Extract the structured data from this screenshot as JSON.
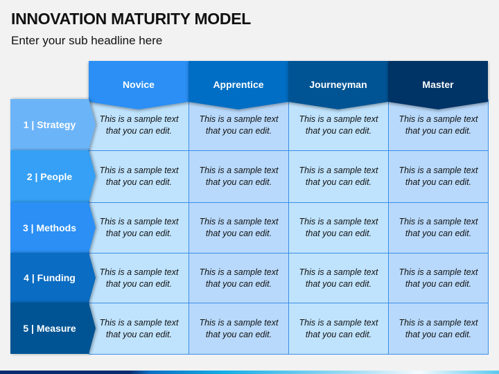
{
  "title": "INNOVATION MATURITY MODEL",
  "subtitle": "Enter your sub headline here",
  "columns": [
    {
      "label": "Novice",
      "color": "#2b8ff5"
    },
    {
      "label": "Apprentice",
      "color": "#006ec4"
    },
    {
      "label": "Journeyman",
      "color": "#005494"
    },
    {
      "label": "Master",
      "color": "#003366"
    }
  ],
  "rows": [
    {
      "label": "1 | Strategy",
      "color": "#6cb4f8",
      "cells": [
        "This is a sample text that you can edit.",
        "This is a sample text that you can edit.",
        "This is a sample text that you can edit.",
        "This is a sample text that you can edit."
      ]
    },
    {
      "label": "2 | People",
      "color": "#35a0f5",
      "cells": [
        "This is a sample text that you can edit.",
        "This is a sample text that you can edit.",
        "This is a sample text that you can edit.",
        "This is a sample text that you can edit."
      ]
    },
    {
      "label": "3 | Methods",
      "color": "#2b8ff5",
      "cells": [
        "This is a sample text that you can edit.",
        "This is a sample text that you can edit.",
        "This is a sample text that you can edit.",
        "This is a sample text that you can edit."
      ]
    },
    {
      "label": "4 | Funding",
      "color": "#0a6cc2",
      "cells": [
        "This is a sample text that you can edit.",
        "This is a sample text that you can edit.",
        "This is a sample text that you can edit.",
        "This is a sample text that you can edit."
      ]
    },
    {
      "label": "5 | Measure",
      "color": "#005494",
      "cells": [
        "This is a sample text that you can edit.",
        "This is a sample text that you can edit.",
        "This is a sample text that you can edit.",
        "This is a sample text that you can edit."
      ]
    }
  ]
}
